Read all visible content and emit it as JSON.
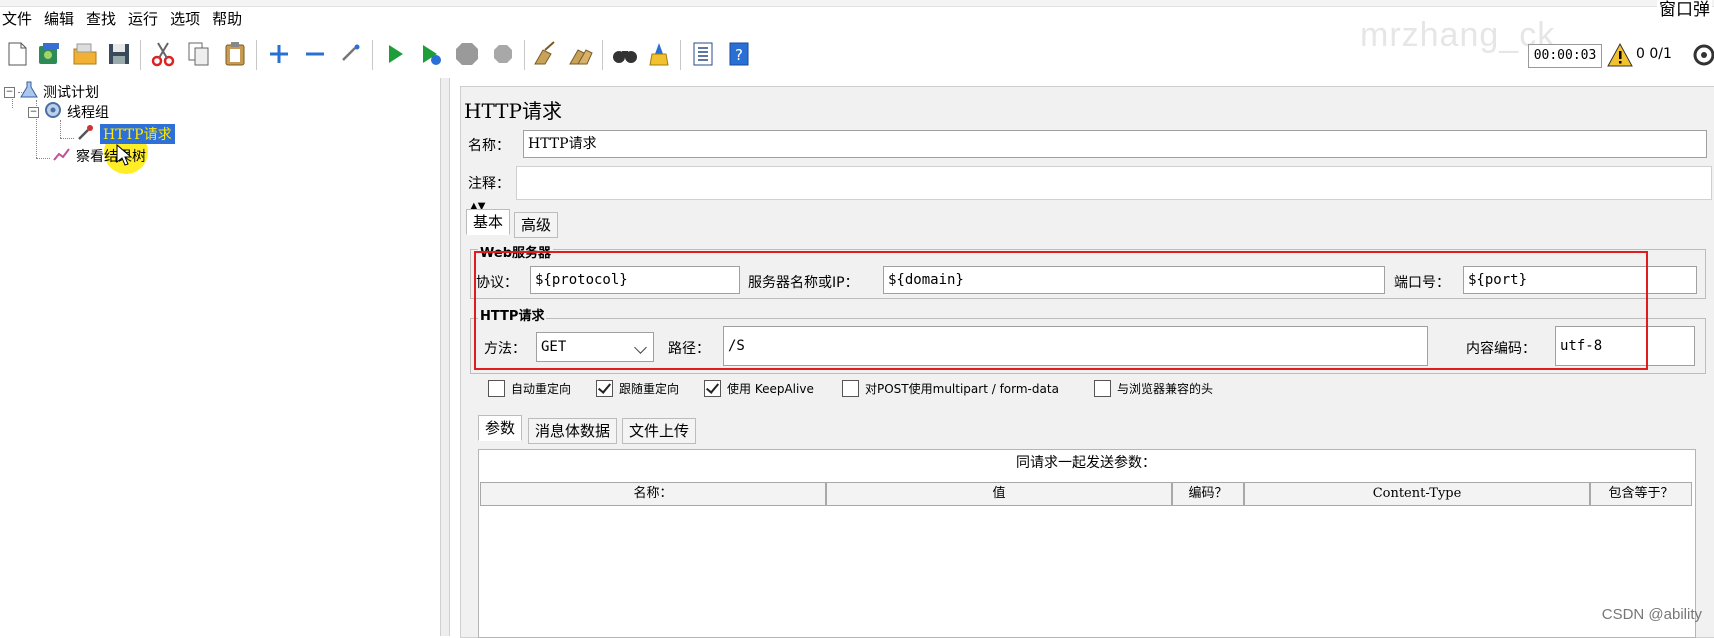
{
  "window": {
    "popup_label": "窗口弹"
  },
  "menu": [
    "文件",
    "编辑",
    "查找",
    "运行",
    "选项",
    "帮助"
  ],
  "status": {
    "timer": "00:00:03",
    "thread_count": "0 0/1"
  },
  "watermark_top": "mrzhang_ck",
  "tree": {
    "root": "测试计划",
    "thread_group": "线程组",
    "selected": "HTTP请求",
    "listener": "察看结果树"
  },
  "panel": {
    "title": "HTTP请求",
    "name_label": "名称：",
    "name_value": "HTTP请求",
    "comment_label": "注释：",
    "tabs": [
      "基本",
      "高级"
    ],
    "web_server": {
      "title": "Web服务器",
      "protocol_label": "协议：",
      "protocol_value": "${protocol}",
      "server_label": "服务器名称或IP：",
      "server_value": "${domain}",
      "port_label": "端口号：",
      "port_value": "${port}"
    },
    "http_request": {
      "title": "HTTP请求",
      "method_label": "方法：",
      "method_value": "GET",
      "path_label": "路径：",
      "path_value": "/S",
      "encoding_label": "内容编码：",
      "encoding_value": "utf-8"
    },
    "checkboxes": [
      {
        "label": "自动重定向",
        "checked": false
      },
      {
        "label": "跟随重定向",
        "checked": true
      },
      {
        "label": "使用 KeepAlive",
        "checked": true
      },
      {
        "label": "对POST使用multipart / form-data",
        "checked": false
      },
      {
        "label": "与浏览器兼容的头",
        "checked": false
      }
    ],
    "sub_tabs": [
      "参数",
      "消息体数据",
      "文件上传"
    ],
    "params_caption": "同请求一起发送参数：",
    "params_columns": [
      "名称：",
      "值",
      "编码？",
      "Content-Type",
      "包含等于？"
    ]
  },
  "footer_watermark": "CSDN @ability",
  "colors": {
    "selection": "#2f6fd8",
    "selection_text": "#ffea00",
    "highlight_box": "#e11c1c"
  }
}
